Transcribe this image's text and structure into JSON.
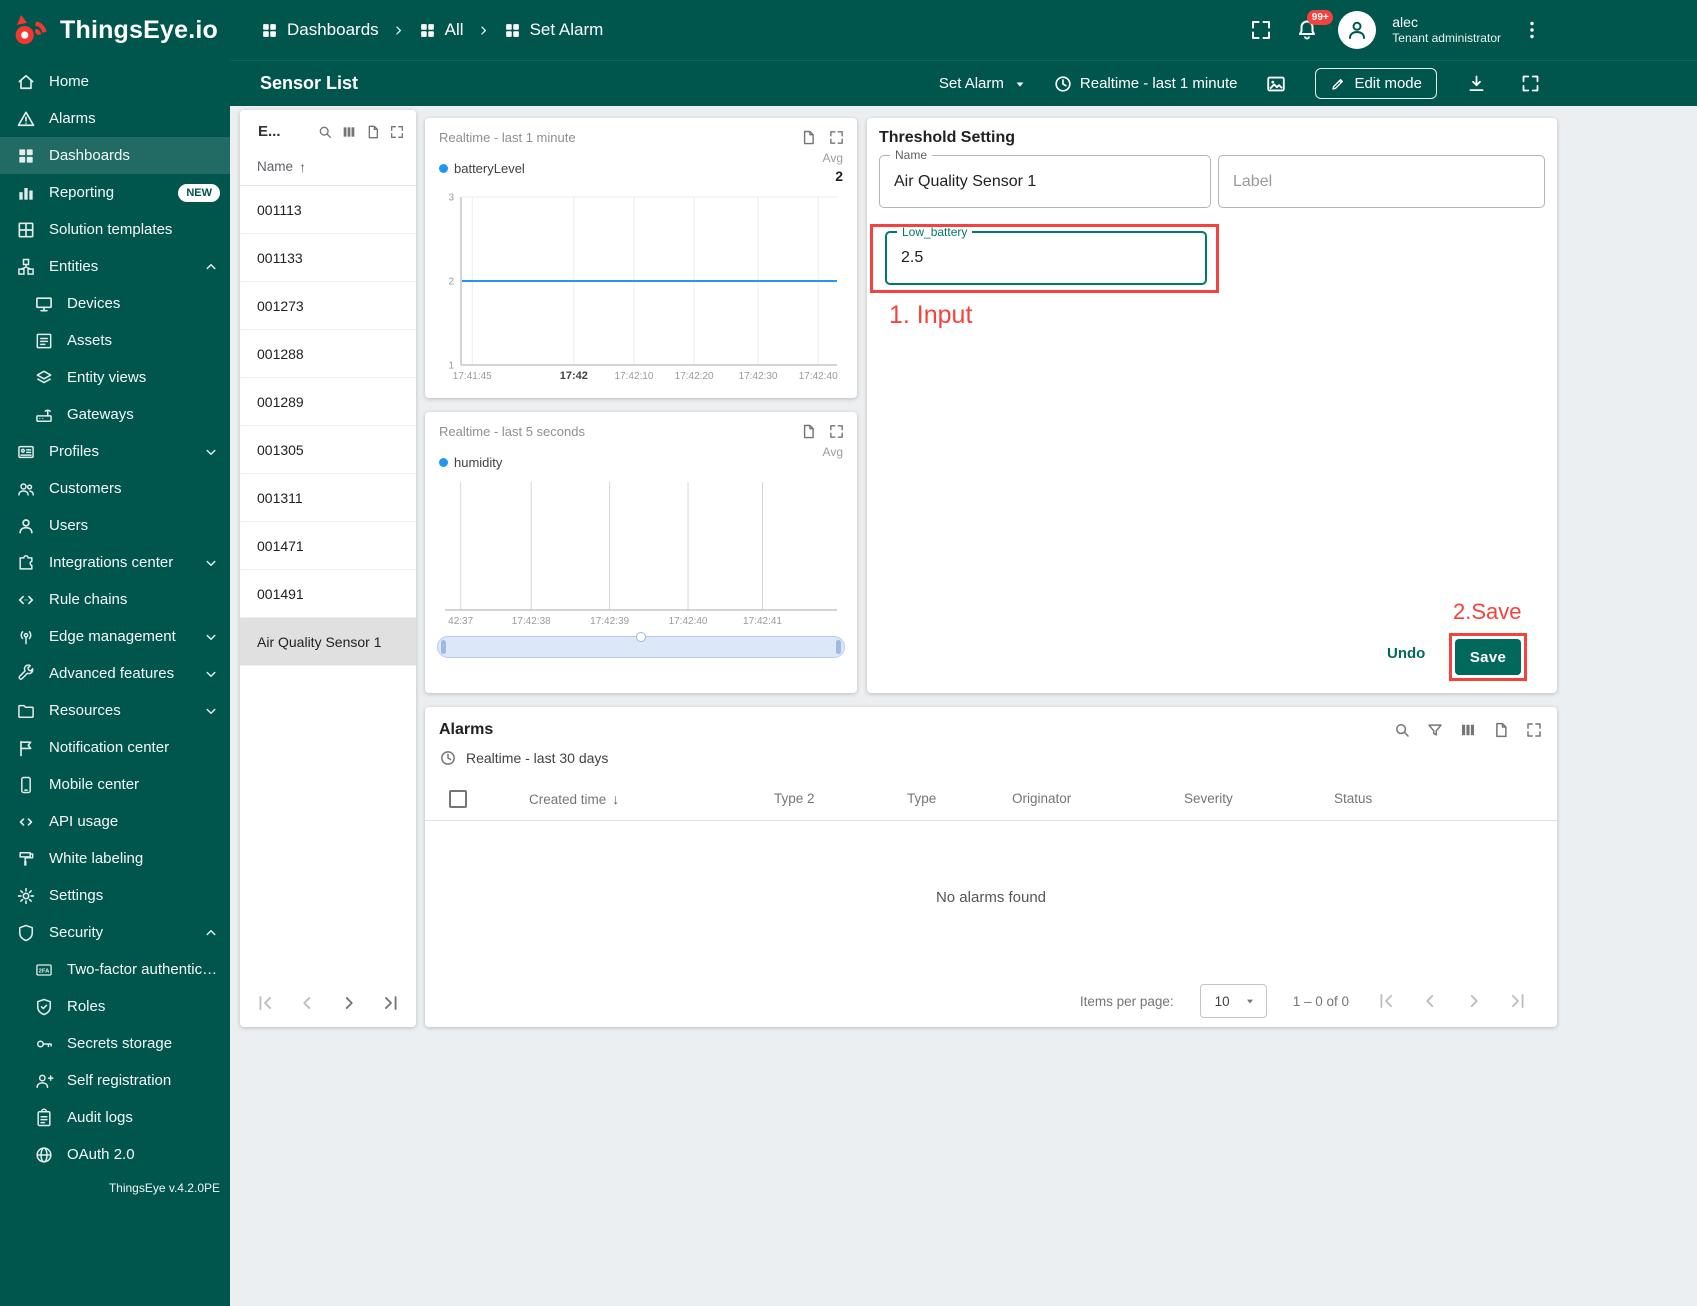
{
  "colors": {
    "teal": "#00564D",
    "accent": "#00695C",
    "focus": "#00796B",
    "annotation_red": "#F4433F",
    "chart_blue": "#2196F3",
    "content_bg": "#ECEFF1",
    "logo_red": "#F3392F"
  },
  "header": {
    "logo_text": "ThingsEye.io",
    "breadcrumb": [
      {
        "label": "Dashboards"
      },
      {
        "label": "All"
      },
      {
        "label": "Set Alarm"
      }
    ],
    "notification_badge": "99+",
    "user_name": "alec",
    "user_role": "Tenant administrator"
  },
  "sidebar": {
    "version": "ThingsEye v.4.2.0PE",
    "items": [
      {
        "label": "Home"
      },
      {
        "label": "Alarms"
      },
      {
        "label": "Dashboards"
      },
      {
        "label": "Reporting",
        "badge": "NEW"
      },
      {
        "label": "Solution templates"
      },
      {
        "label": "Entities"
      },
      {
        "label": "Devices"
      },
      {
        "label": "Assets"
      },
      {
        "label": "Entity views"
      },
      {
        "label": "Gateways"
      },
      {
        "label": "Profiles"
      },
      {
        "label": "Customers"
      },
      {
        "label": "Users"
      },
      {
        "label": "Integrations center"
      },
      {
        "label": "Rule chains"
      },
      {
        "label": "Edge management"
      },
      {
        "label": "Advanced features"
      },
      {
        "label": "Resources"
      },
      {
        "label": "Notification center"
      },
      {
        "label": "Mobile center"
      },
      {
        "label": "API usage"
      },
      {
        "label": "White labeling"
      },
      {
        "label": "Settings"
      },
      {
        "label": "Security"
      },
      {
        "label": "Two-factor authenticati..."
      },
      {
        "label": "Roles"
      },
      {
        "label": "Secrets storage"
      },
      {
        "label": "Self registration"
      },
      {
        "label": "Audit logs"
      },
      {
        "label": "OAuth 2.0"
      }
    ]
  },
  "toolbar": {
    "title": "Sensor List",
    "state_button": "Set Alarm",
    "timewindow": "Realtime - last 1 minute",
    "edit_mode": "Edit mode"
  },
  "entity_list": {
    "title": "E...",
    "name_column": "Name",
    "rows": [
      "001113",
      "001133",
      "001273",
      "001288",
      "001289",
      "001305",
      "001311",
      "001471",
      "001491",
      "Air Quality Sensor 1"
    ],
    "selected_row": "Air Quality Sensor 1"
  },
  "threshold": {
    "title": "Threshold Setting",
    "name_label": "Name",
    "name_value": "Air Quality Sensor 1",
    "label_placeholder": "Label",
    "low_battery_label": "Low_battery",
    "low_battery_value": "2.5",
    "undo": "Undo",
    "save": "Save",
    "annotation_input": "1. Input",
    "annotation_save": "2.Save"
  },
  "alarms": {
    "title": "Alarms",
    "timewindow": "Realtime - last 30 days",
    "columns": [
      "Created time",
      "Type 2",
      "Type",
      "Originator",
      "Severity",
      "Status"
    ],
    "empty": "No alarms found",
    "items_per_page_label": "Items per page:",
    "items_per_page": "10",
    "range": "1 – 0 of 0"
  },
  "chart_data": [
    {
      "id": "battery",
      "type": "line",
      "title": "Realtime - last 1 minute",
      "agg_label": "Avg",
      "agg_value": "2",
      "series": [
        {
          "name": "batteryLevel",
          "color": "#2196F3",
          "constant_value": 2
        }
      ],
      "ylim": [
        1,
        3
      ],
      "y_ticks": [
        3,
        2,
        1
      ],
      "x_ticks": [
        "17:41:45",
        "17:42",
        "17:42:10",
        "17:42:20",
        "17:42:30",
        "17:42:40"
      ],
      "x_fracs": [
        0.03,
        0.3,
        0.46,
        0.62,
        0.79,
        0.95
      ],
      "emphasized_tick": "17:42",
      "grid": true,
      "legend_position": "top-left"
    },
    {
      "id": "humidity",
      "type": "line",
      "title": "Realtime - last 5 seconds",
      "agg_label": "Avg",
      "agg_value": "",
      "series": [
        {
          "name": "humidity",
          "color": "#2196F3"
        }
      ],
      "x_ticks": [
        "42:37",
        "17:42:38",
        "17:42:39",
        "17:42:40",
        "17:42:41"
      ],
      "x_fracs": [
        0.04,
        0.22,
        0.42,
        0.62,
        0.81
      ],
      "grid": true,
      "legend_position": "top-left"
    }
  ]
}
